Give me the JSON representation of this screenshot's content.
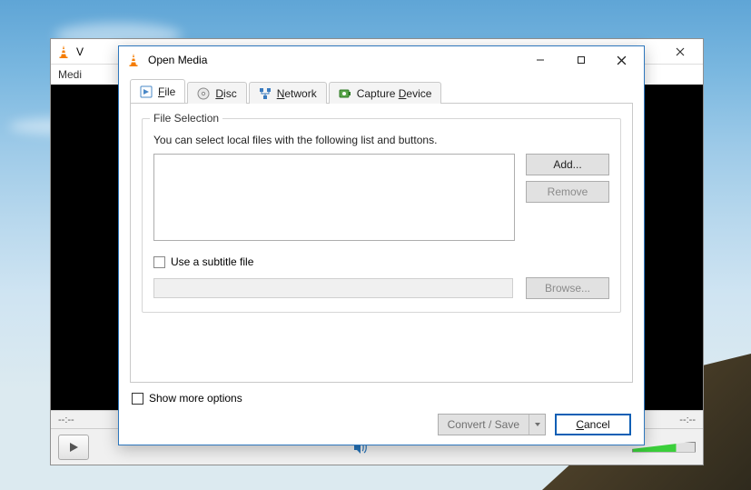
{
  "vlc_main": {
    "title_prefix": "V",
    "menu_first": "Medi",
    "time_left": "--:--",
    "time_right": "--:--"
  },
  "dialog": {
    "title": "Open Media",
    "tabs": {
      "file": {
        "pre": "",
        "u": "F",
        "post": "ile"
      },
      "disc": {
        "pre": "",
        "u": "D",
        "post": "isc"
      },
      "network": {
        "pre": "",
        "u": "N",
        "post": "etwork"
      },
      "capture": {
        "pre": "Capture ",
        "u": "D",
        "post": "evice"
      }
    },
    "file_section": {
      "group_title": "File Selection",
      "hint": "You can select local files with the following list and buttons.",
      "add_label": "Add...",
      "remove_label": "Remove",
      "subtitle_checkbox_label": "Use a subtitle file",
      "browse_label": "Browse..."
    },
    "show_more_label": "Show more options",
    "convert_label": "Convert / Save",
    "cancel": {
      "u": "C",
      "post": "ancel"
    }
  }
}
